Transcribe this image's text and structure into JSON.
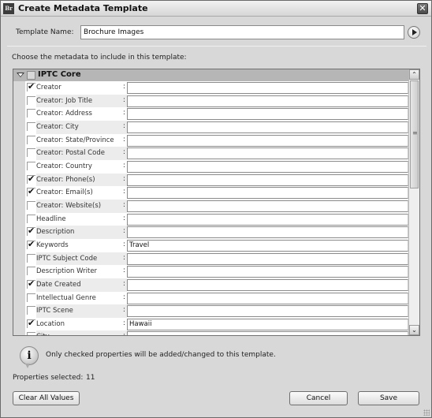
{
  "window": {
    "title": "Create Metadata Template",
    "app_icon": "Br",
    "close_icon": "✕"
  },
  "template_name": {
    "label": "Template Name:",
    "value": "Brochure Images"
  },
  "instruction": "Choose the metadata to include in this template:",
  "group": {
    "label": "IPTC Core",
    "expanded": true,
    "checked": false
  },
  "rows": [
    {
      "label": "Creator",
      "checked": true,
      "value": ""
    },
    {
      "label": "Creator: Job Title",
      "checked": false,
      "value": ""
    },
    {
      "label": "Creator: Address",
      "checked": false,
      "value": ""
    },
    {
      "label": "Creator: City",
      "checked": false,
      "value": ""
    },
    {
      "label": "Creator: State/Province",
      "checked": false,
      "value": ""
    },
    {
      "label": "Creator: Postal Code",
      "checked": false,
      "value": ""
    },
    {
      "label": "Creator: Country",
      "checked": false,
      "value": ""
    },
    {
      "label": "Creator: Phone(s)",
      "checked": true,
      "value": ""
    },
    {
      "label": "Creator: Email(s)",
      "checked": true,
      "value": ""
    },
    {
      "label": "Creator: Website(s)",
      "checked": false,
      "value": ""
    },
    {
      "label": "Headline",
      "checked": false,
      "value": ""
    },
    {
      "label": "Description",
      "checked": true,
      "value": ""
    },
    {
      "label": "Keywords",
      "checked": true,
      "value": "Travel"
    },
    {
      "label": "IPTC Subject Code",
      "checked": false,
      "value": ""
    },
    {
      "label": "Description Writer",
      "checked": false,
      "value": ""
    },
    {
      "label": "Date Created",
      "checked": true,
      "value": ""
    },
    {
      "label": "Intellectual Genre",
      "checked": false,
      "value": ""
    },
    {
      "label": "IPTC Scene",
      "checked": false,
      "value": ""
    },
    {
      "label": "Location",
      "checked": true,
      "value": "Hawaii"
    },
    {
      "label": "City",
      "checked": false,
      "value": ""
    }
  ],
  "info_message": "Only checked properties will be added/changed to this template.",
  "properties_selected": {
    "label": "Properties selected:",
    "count": "11"
  },
  "buttons": {
    "clear_all": "Clear All Values",
    "cancel": "Cancel",
    "save": "Save"
  }
}
